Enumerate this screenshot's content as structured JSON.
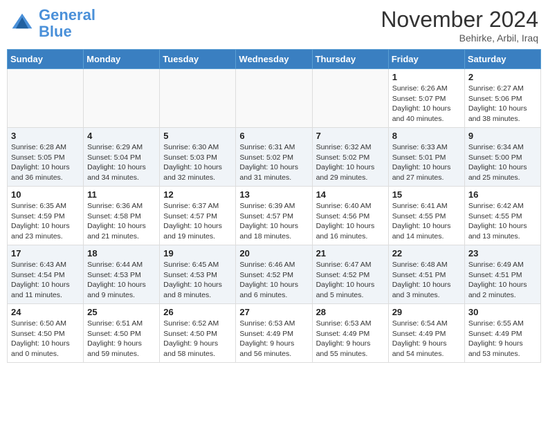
{
  "header": {
    "logo_line1": "General",
    "logo_line2": "Blue",
    "month_title": "November 2024",
    "location": "Behirke, Arbil, Iraq"
  },
  "weekdays": [
    "Sunday",
    "Monday",
    "Tuesday",
    "Wednesday",
    "Thursday",
    "Friday",
    "Saturday"
  ],
  "weeks": [
    [
      {
        "day": "",
        "info": ""
      },
      {
        "day": "",
        "info": ""
      },
      {
        "day": "",
        "info": ""
      },
      {
        "day": "",
        "info": ""
      },
      {
        "day": "",
        "info": ""
      },
      {
        "day": "1",
        "info": "Sunrise: 6:26 AM\nSunset: 5:07 PM\nDaylight: 10 hours and 40 minutes."
      },
      {
        "day": "2",
        "info": "Sunrise: 6:27 AM\nSunset: 5:06 PM\nDaylight: 10 hours and 38 minutes."
      }
    ],
    [
      {
        "day": "3",
        "info": "Sunrise: 6:28 AM\nSunset: 5:05 PM\nDaylight: 10 hours and 36 minutes."
      },
      {
        "day": "4",
        "info": "Sunrise: 6:29 AM\nSunset: 5:04 PM\nDaylight: 10 hours and 34 minutes."
      },
      {
        "day": "5",
        "info": "Sunrise: 6:30 AM\nSunset: 5:03 PM\nDaylight: 10 hours and 32 minutes."
      },
      {
        "day": "6",
        "info": "Sunrise: 6:31 AM\nSunset: 5:02 PM\nDaylight: 10 hours and 31 minutes."
      },
      {
        "day": "7",
        "info": "Sunrise: 6:32 AM\nSunset: 5:02 PM\nDaylight: 10 hours and 29 minutes."
      },
      {
        "day": "8",
        "info": "Sunrise: 6:33 AM\nSunset: 5:01 PM\nDaylight: 10 hours and 27 minutes."
      },
      {
        "day": "9",
        "info": "Sunrise: 6:34 AM\nSunset: 5:00 PM\nDaylight: 10 hours and 25 minutes."
      }
    ],
    [
      {
        "day": "10",
        "info": "Sunrise: 6:35 AM\nSunset: 4:59 PM\nDaylight: 10 hours and 23 minutes."
      },
      {
        "day": "11",
        "info": "Sunrise: 6:36 AM\nSunset: 4:58 PM\nDaylight: 10 hours and 21 minutes."
      },
      {
        "day": "12",
        "info": "Sunrise: 6:37 AM\nSunset: 4:57 PM\nDaylight: 10 hours and 19 minutes."
      },
      {
        "day": "13",
        "info": "Sunrise: 6:39 AM\nSunset: 4:57 PM\nDaylight: 10 hours and 18 minutes."
      },
      {
        "day": "14",
        "info": "Sunrise: 6:40 AM\nSunset: 4:56 PM\nDaylight: 10 hours and 16 minutes."
      },
      {
        "day": "15",
        "info": "Sunrise: 6:41 AM\nSunset: 4:55 PM\nDaylight: 10 hours and 14 minutes."
      },
      {
        "day": "16",
        "info": "Sunrise: 6:42 AM\nSunset: 4:55 PM\nDaylight: 10 hours and 13 minutes."
      }
    ],
    [
      {
        "day": "17",
        "info": "Sunrise: 6:43 AM\nSunset: 4:54 PM\nDaylight: 10 hours and 11 minutes."
      },
      {
        "day": "18",
        "info": "Sunrise: 6:44 AM\nSunset: 4:53 PM\nDaylight: 10 hours and 9 minutes."
      },
      {
        "day": "19",
        "info": "Sunrise: 6:45 AM\nSunset: 4:53 PM\nDaylight: 10 hours and 8 minutes."
      },
      {
        "day": "20",
        "info": "Sunrise: 6:46 AM\nSunset: 4:52 PM\nDaylight: 10 hours and 6 minutes."
      },
      {
        "day": "21",
        "info": "Sunrise: 6:47 AM\nSunset: 4:52 PM\nDaylight: 10 hours and 5 minutes."
      },
      {
        "day": "22",
        "info": "Sunrise: 6:48 AM\nSunset: 4:51 PM\nDaylight: 10 hours and 3 minutes."
      },
      {
        "day": "23",
        "info": "Sunrise: 6:49 AM\nSunset: 4:51 PM\nDaylight: 10 hours and 2 minutes."
      }
    ],
    [
      {
        "day": "24",
        "info": "Sunrise: 6:50 AM\nSunset: 4:50 PM\nDaylight: 10 hours and 0 minutes."
      },
      {
        "day": "25",
        "info": "Sunrise: 6:51 AM\nSunset: 4:50 PM\nDaylight: 9 hours and 59 minutes."
      },
      {
        "day": "26",
        "info": "Sunrise: 6:52 AM\nSunset: 4:50 PM\nDaylight: 9 hours and 58 minutes."
      },
      {
        "day": "27",
        "info": "Sunrise: 6:53 AM\nSunset: 4:49 PM\nDaylight: 9 hours and 56 minutes."
      },
      {
        "day": "28",
        "info": "Sunrise: 6:53 AM\nSunset: 4:49 PM\nDaylight: 9 hours and 55 minutes."
      },
      {
        "day": "29",
        "info": "Sunrise: 6:54 AM\nSunset: 4:49 PM\nDaylight: 9 hours and 54 minutes."
      },
      {
        "day": "30",
        "info": "Sunrise: 6:55 AM\nSunset: 4:49 PM\nDaylight: 9 hours and 53 minutes."
      }
    ]
  ]
}
